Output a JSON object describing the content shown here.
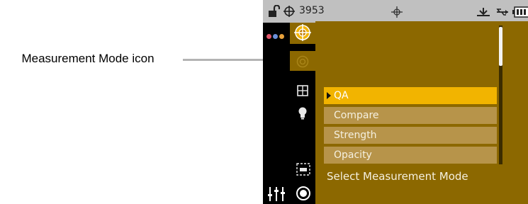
{
  "callout": {
    "label": "Measurement Mode icon"
  },
  "statusbar": {
    "counter": "3953"
  },
  "modes": {
    "items": [
      {
        "label": "QA",
        "selected": true
      },
      {
        "label": "Compare",
        "selected": false
      },
      {
        "label": "Strength",
        "selected": false
      },
      {
        "label": "Opacity",
        "selected": false
      }
    ],
    "prompt": "Select Measurement Mode"
  },
  "colors": {
    "panel": "#8c6800",
    "selected_item": "#f2b400",
    "item": "#b7944a",
    "statusbar": "#c0c0c0"
  },
  "icons": [
    "unlock-icon",
    "crosshair-icon",
    "target-icon",
    "antenna-icon",
    "usb-icon",
    "battery-icon",
    "dots-icon",
    "reticle-icon",
    "measurement-mode-icon",
    "grid-icon",
    "bulb-icon",
    "frame-icon",
    "sliders-icon",
    "record-icon"
  ]
}
